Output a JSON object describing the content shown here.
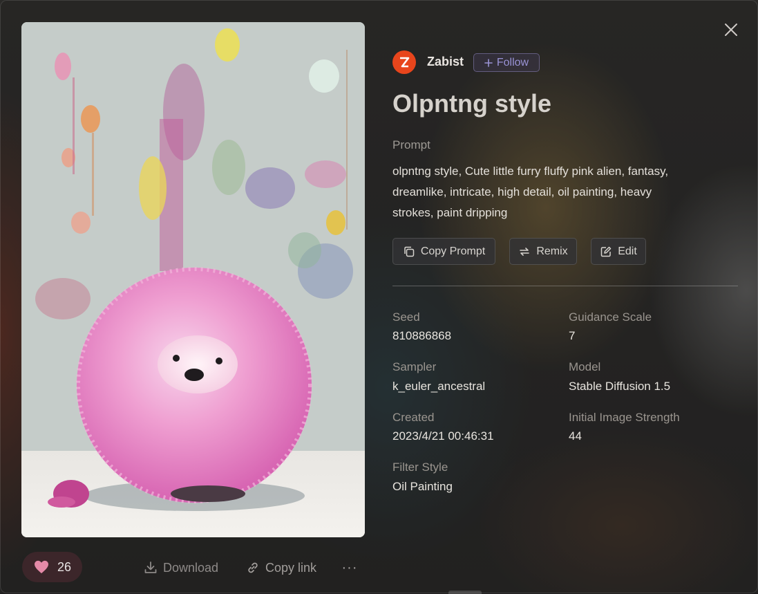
{
  "author": {
    "name": "Zabist",
    "follow_label": "Follow"
  },
  "title": "Olpntng style",
  "prompt": {
    "label": "Prompt",
    "text": "olpntng style, Cute little furry fluffy pink alien, fantasy, dreamlike, intricate, high detail, oil painting, heavy strokes, paint dripping"
  },
  "actions": {
    "copy_prompt": "Copy Prompt",
    "remix": "Remix",
    "edit": "Edit"
  },
  "meta": {
    "seed_label": "Seed",
    "seed_value": "810886868",
    "guidance_label": "Guidance Scale",
    "guidance_value": "7",
    "sampler_label": "Sampler",
    "sampler_value": "k_euler_ancestral",
    "model_label": "Model",
    "model_value": "Stable Diffusion 1.5",
    "created_label": "Created",
    "created_value": "2023/4/21 00:46:31",
    "strength_label": "Initial Image Strength",
    "strength_value": "44",
    "filter_label": "Filter Style",
    "filter_value": "Oil Painting"
  },
  "footer": {
    "likes": "26",
    "download": "Download",
    "copy_link": "Copy link",
    "more": "···"
  },
  "colors": {
    "avatar": "#e8451c",
    "follow_accent": "#9a93d6",
    "like_heart": "#e48aa7"
  },
  "icons": [
    "close-icon",
    "heart-icon",
    "download-icon",
    "link-icon",
    "more-icon",
    "avatar-logo-icon",
    "plus-icon",
    "copy-icon",
    "remix-icon",
    "edit-icon"
  ]
}
